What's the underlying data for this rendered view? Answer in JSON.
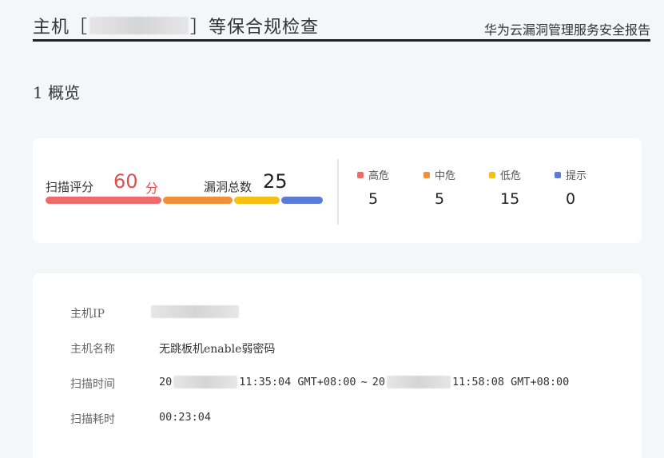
{
  "header": {
    "title_prefix": "主机［",
    "title_suffix": "］等保合规检查",
    "subtitle": "华为云漏洞管理服务安全报告"
  },
  "section": {
    "heading": "1 概览"
  },
  "summary": {
    "score_label": "扫描评分",
    "score_value": "60",
    "score_unit": "分",
    "total_label": "漏洞总数",
    "total_value": "25",
    "bar": [
      {
        "name": "red",
        "color": "#ee6b6b",
        "fraction": 0.42
      },
      {
        "name": "orange",
        "color": "#f0913a",
        "fraction": 0.25
      },
      {
        "name": "yellow",
        "color": "#f5c013",
        "fraction": 0.165
      },
      {
        "name": "blue",
        "color": "#5a7bd6",
        "fraction": 0.15
      }
    ],
    "levels": [
      {
        "label": "高危",
        "count": "5",
        "color": "#ee6b6b"
      },
      {
        "label": "中危",
        "count": "5",
        "color": "#f0913a"
      },
      {
        "label": "低危",
        "count": "15",
        "color": "#f5c013"
      },
      {
        "label": "提示",
        "count": "0",
        "color": "#5a7bd6"
      }
    ]
  },
  "info": {
    "host_ip_label": "主机IP",
    "host_name_label": "主机名称",
    "host_name_value": "无跳板机enable弱密码",
    "scan_time_label": "扫描时间",
    "scan_start_prefix": "20",
    "scan_start_suffix": "11:35:04 GMT+08:00",
    "scan_separator": "~",
    "scan_end_prefix": "20",
    "scan_end_suffix": "11:58:08 GMT+08:00",
    "scan_duration_label": "扫描耗时",
    "scan_duration_value": "00:23:04"
  }
}
